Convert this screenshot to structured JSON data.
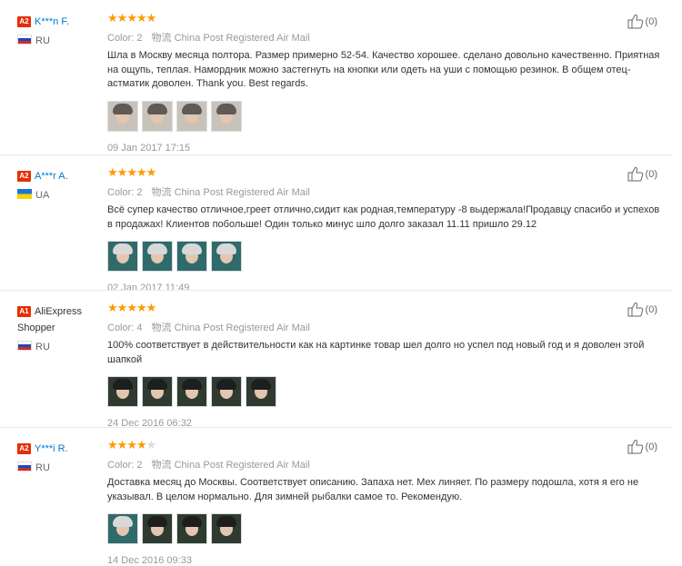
{
  "reviews": [
    {
      "user_level": "A2",
      "user_name": "K***n F.",
      "country_code": "RU",
      "country_flag": "ru",
      "stars": 5,
      "color_label": "Color:",
      "color_value": "2",
      "logistics_glyph": "物流",
      "logistics": "China Post Registered Air Mail",
      "text": "Шла в Москву месяца полтора. Размер примерно 52-54. Качество хорошее. сделано довольно качественно. Приятная на ощупь, теплая. Намордник можно застегнуть на кнопки или одеть на уши с помощью резинок. В общем отец-астматик доволен. Thank you. Best regards.",
      "photos": [
        "light",
        "light",
        "light",
        "light"
      ],
      "date": "09 Jan 2017 17:15",
      "helpful_count": "(0)"
    },
    {
      "user_level": "A2",
      "user_name": "A***r A.",
      "country_code": "UA",
      "country_flag": "ua",
      "stars": 5,
      "color_label": "Color:",
      "color_value": "2",
      "logistics_glyph": "物流",
      "logistics": "China Post Registered Air Mail",
      "text": "Всё супер качество отличное,греет отлично,сидит как родная,температуру -8 выдержала!Продавцу спасибо и успехов в продажах! Клиентов побольше! Один только минус шло долго заказал 11.11 пришло 29.12",
      "photos": [
        "teal",
        "teal",
        "teal",
        "teal"
      ],
      "date": "02 Jan 2017 11:49",
      "helpful_count": "(0)"
    },
    {
      "user_level": "A1",
      "user_name": "AliExpress Shopper",
      "country_code": "RU",
      "country_flag": "ru",
      "stars": 5,
      "color_label": "Color:",
      "color_value": "4",
      "logistics_glyph": "物流",
      "logistics": "China Post Registered Air Mail",
      "text": "100% соответствует в действительности как на картинке товар шел долго но успел под новый год и я доволен этой шапкой",
      "photos": [
        "dark",
        "dark",
        "dark",
        "dark",
        "dark"
      ],
      "date": "24 Dec 2016 06:32",
      "helpful_count": "(0)"
    },
    {
      "user_level": "A2",
      "user_name": "Y***i R.",
      "country_code": "RU",
      "country_flag": "ru",
      "stars": 4,
      "color_label": "Color:",
      "color_value": "2",
      "logistics_glyph": "物流",
      "logistics": "China Post Registered Air Mail",
      "text": "Доставка месяц до Москвы. Соответствует описанию. Запаха нет. Мех линяет. По размеру подошла, хотя я его не указывал. В целом нормально. Для зимней рыбалки самое то. Рекомендую.",
      "photos": [
        "teal",
        "dark",
        "dark",
        "dark"
      ],
      "date": "14 Dec 2016 09:33",
      "helpful_count": "(0)"
    }
  ],
  "colors": {
    "star": "#ff9900",
    "level_badge": "#e62e04",
    "user_link": "#0077cc"
  }
}
